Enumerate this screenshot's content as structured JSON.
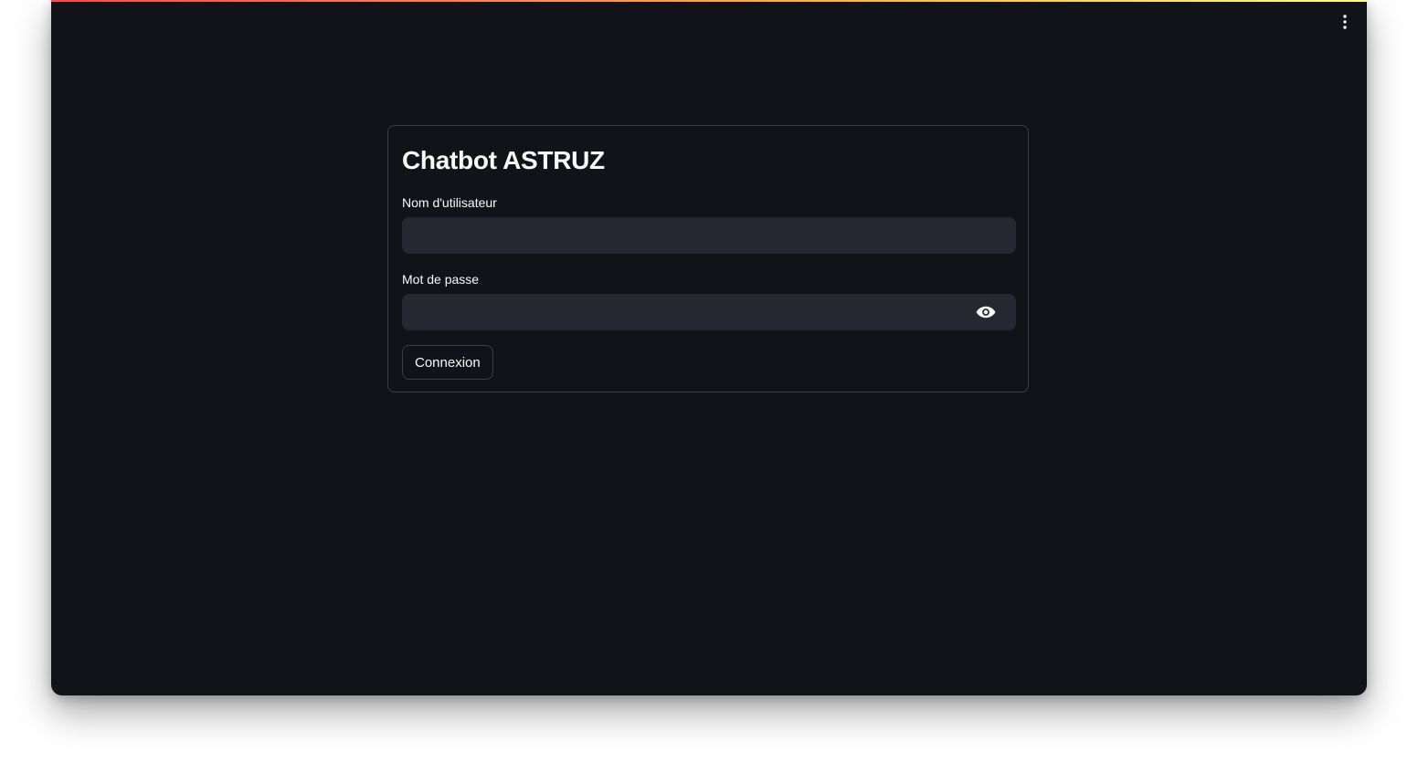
{
  "app": {
    "title": "Chatbot ASTRUZ",
    "accent_gradient": [
      "#ff4b4b",
      "#ffb347",
      "#fffd80"
    ],
    "background": "#111319"
  },
  "header": {
    "menu_icon": "vertical-ellipsis-icon"
  },
  "login_form": {
    "username": {
      "label": "Nom d'utilisateur",
      "value": "",
      "placeholder": ""
    },
    "password": {
      "label": "Mot de passe",
      "value": "",
      "placeholder": "",
      "toggle_icon": "eye-icon"
    },
    "submit_label": "Connexion"
  }
}
